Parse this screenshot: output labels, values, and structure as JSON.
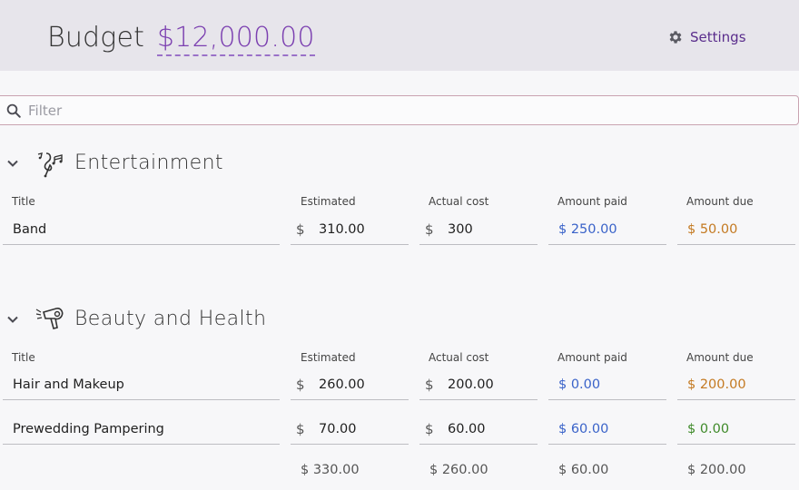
{
  "header": {
    "title": "Budget",
    "amount": "$12,000.00",
    "settings_label": "Settings"
  },
  "filter": {
    "placeholder": "Filter"
  },
  "columns": {
    "title": "Title",
    "estimated": "Estimated",
    "actual": "Actual cost",
    "paid": "Amount paid",
    "due": "Amount due"
  },
  "currency_symbol": "$",
  "categories": [
    {
      "name": "Entertainment",
      "icon": "music-notes-icon",
      "items": [
        {
          "title": "Band",
          "estimated": "310.00",
          "actual": "300",
          "paid": "$ 250.00",
          "due": "$ 50.00"
        }
      ]
    },
    {
      "name": "Beauty and Health",
      "icon": "hair-dryer-icon",
      "items": [
        {
          "title": "Hair and Makeup",
          "estimated": "260.00",
          "actual": "200.00",
          "paid": "$ 0.00",
          "due": "$ 200.00"
        },
        {
          "title": "Prewedding Pampering",
          "estimated": "70.00",
          "actual": "60.00",
          "paid": "$ 60.00",
          "due": "$ 0.00"
        }
      ],
      "totals": {
        "estimated": "$ 330.00",
        "actual": "$ 260.00",
        "paid": "$ 60.00",
        "due": "$ 200.00"
      }
    }
  ],
  "colors": {
    "accent": "#7b3fb0",
    "paid": "#3a63c9",
    "due_outstanding": "#c47a22",
    "due_settled": "#3f8a2a"
  }
}
